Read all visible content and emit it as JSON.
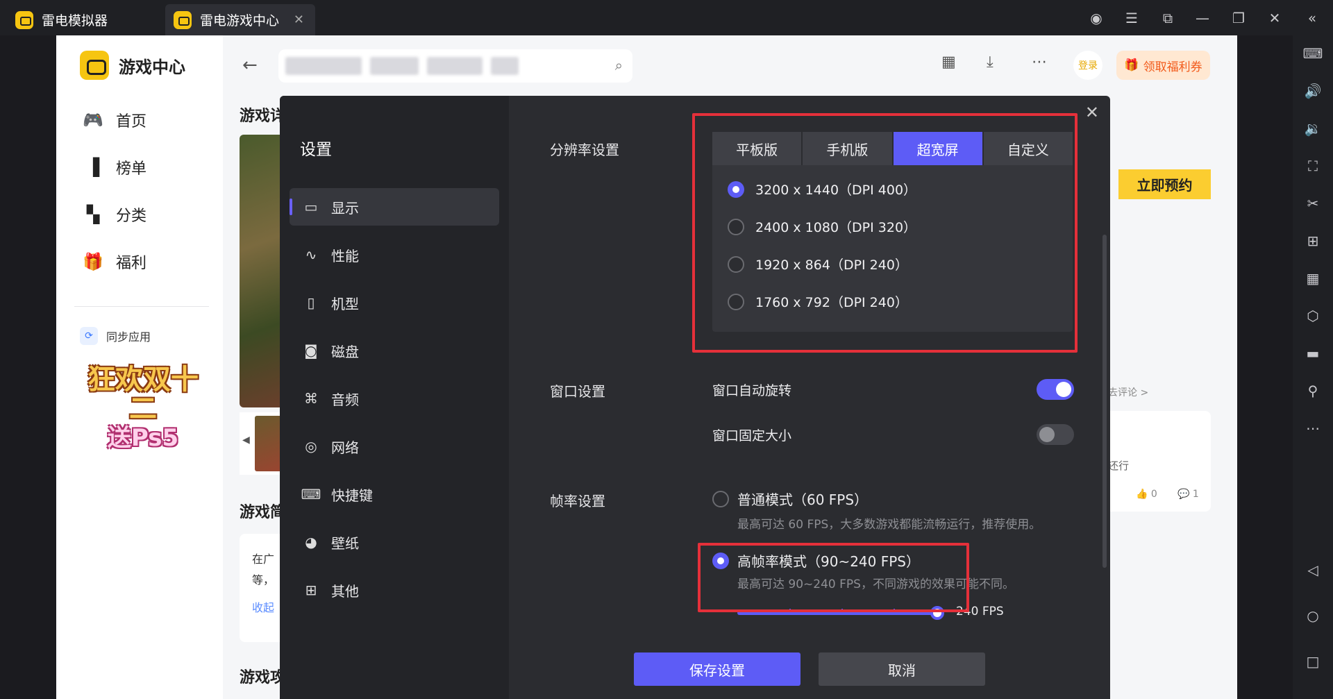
{
  "titlebar": {
    "tabs": [
      {
        "label": "雷电模拟器"
      },
      {
        "label": "雷电游戏中心"
      }
    ],
    "controls": [
      "user-icon",
      "menu-icon",
      "popout-icon",
      "minimize-icon",
      "restore-icon",
      "close-icon",
      "collapse-icon"
    ]
  },
  "right_toolbar": [
    "keyboard-icon",
    "volume-up-icon",
    "volume-down-icon",
    "screenshot-icon",
    "cut-icon",
    "add-window-icon",
    "apk-icon",
    "settings-hex-icon",
    "folder-icon",
    "location-icon",
    "more-icon",
    "back-icon",
    "home-icon",
    "recent-icon"
  ],
  "app": {
    "brand": "游戏中心",
    "nav": [
      {
        "label": "首页"
      },
      {
        "label": "榜单"
      },
      {
        "label": "分类"
      },
      {
        "label": "福利"
      }
    ],
    "sync_label": "同步应用",
    "promo": {
      "line1": "狂欢双十二",
      "line2": "送Ps5"
    },
    "header": {
      "login": "登录",
      "coupon": "领取福利券"
    },
    "content": {
      "section1": "游戏详",
      "section2": "游戏简",
      "section3": "游戏攻",
      "card_line1": "在广",
      "card_line2": "等，",
      "card_link": "收起",
      "reserve": "立即预约",
      "comment_link": "去评论 >",
      "comment_text": "还行",
      "likes": "0",
      "replies": "1"
    }
  },
  "settings": {
    "title": "设置",
    "sidebar": [
      {
        "label": "显示",
        "icon": "monitor-icon",
        "active": true
      },
      {
        "label": "性能",
        "icon": "pulse-icon"
      },
      {
        "label": "机型",
        "icon": "device-icon"
      },
      {
        "label": "磁盘",
        "icon": "disk-icon"
      },
      {
        "label": "音频",
        "icon": "gamepad-icon"
      },
      {
        "label": "网络",
        "icon": "globe-icon"
      },
      {
        "label": "快捷键",
        "icon": "keyboard-icon"
      },
      {
        "label": "壁纸",
        "icon": "palette-icon"
      },
      {
        "label": "其他",
        "icon": "grid-icon"
      }
    ],
    "resolution": {
      "label": "分辨率设置",
      "tabs": [
        "平板版",
        "手机版",
        "超宽屏",
        "自定义"
      ],
      "selected_tab": "超宽屏",
      "options": [
        "3200 x 1440（DPI 400）",
        "2400 x 1080（DPI 320）",
        "1920 x 864（DPI 240）",
        "1760 x 792（DPI 240）"
      ],
      "selected_index": 0
    },
    "window": {
      "label": "窗口设置",
      "auto_rotate": {
        "label": "窗口自动旋转",
        "on": true
      },
      "fixed_size": {
        "label": "窗口固定大小",
        "on": false
      }
    },
    "framerate": {
      "label": "帧率设置",
      "normal": {
        "label": "普通模式（60 FPS）",
        "desc": "最高可达 60 FPS，大多数游戏都能流畅运行，推荐使用。",
        "selected": false
      },
      "high": {
        "label": "高帧率模式（90~240 FPS）",
        "desc": "最高可达 90~240 FPS，不同游戏的效果可能不同。",
        "selected": true
      },
      "slider_value": "240 FPS",
      "slider_fraction": 1.0
    },
    "buttons": {
      "save": "保存设置",
      "cancel": "取消"
    },
    "highlight_color": "#e5303a",
    "accent_color": "#5d5cf6"
  }
}
